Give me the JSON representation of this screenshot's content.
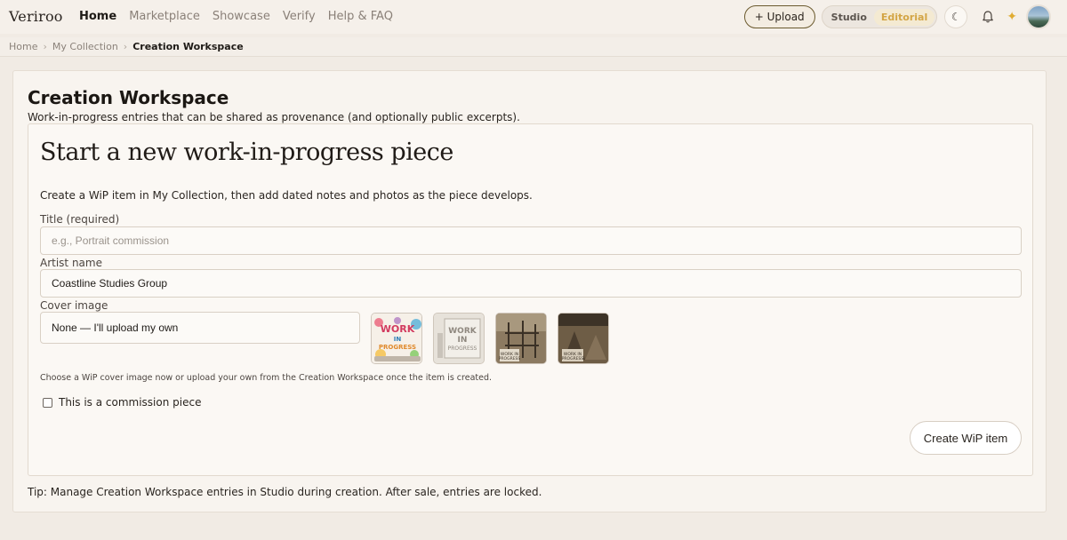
{
  "app": {
    "logo": "Veriroo"
  },
  "nav": {
    "items": [
      "Home",
      "Marketplace",
      "Showcase",
      "Verify",
      "Help & FAQ"
    ],
    "active_index": 0
  },
  "toolbar": {
    "upload_label": "+ Upload",
    "mode_options": [
      "Studio",
      "Editorial"
    ],
    "mode_selected": "Editorial",
    "theme_icon": "moon-icon",
    "notifications_icon": "bell-icon",
    "sparkle_icon": "sparkle-icon"
  },
  "breadcrumb": {
    "items": [
      "Home",
      "My Collection"
    ],
    "current": "Creation Workspace",
    "separator": "›"
  },
  "workspace": {
    "title": "Creation Workspace",
    "subtitle": "Work-in-progress entries that can be shared as provenance (and optionally public excerpts)."
  },
  "form": {
    "heading": "Start a new work-in-progress piece",
    "description": "Create a WiP item in My Collection, then add dated notes and photos as the piece develops.",
    "title_label": "Title (required)",
    "title_placeholder": "e.g., Portrait commission",
    "title_value": "",
    "artist_label": "Artist name",
    "artist_value": "Coastline Studies Group",
    "cover_label": "Cover image",
    "cover_selected": "None — I'll upload my own",
    "cover_hint": "Choose a WiP cover image now or upload your own from the Creation Workspace once the item is created.",
    "commission_label": "This is a commission piece",
    "commission_checked": false,
    "submit_label": "Create WiP item"
  },
  "cover_thumbs": [
    {
      "text": [
        "WORK",
        "IN",
        "PROGRESS"
      ]
    },
    {
      "text": [
        "WORK",
        "IN",
        "PROGRESS"
      ]
    },
    {
      "text": [
        "WORK IN",
        "PROGRESS"
      ]
    },
    {
      "text": [
        "WORK IN",
        "PROGRESS"
      ]
    }
  ],
  "tip": "Tip: Manage Creation Workspace entries in Studio during creation. After sale, entries are locked."
}
